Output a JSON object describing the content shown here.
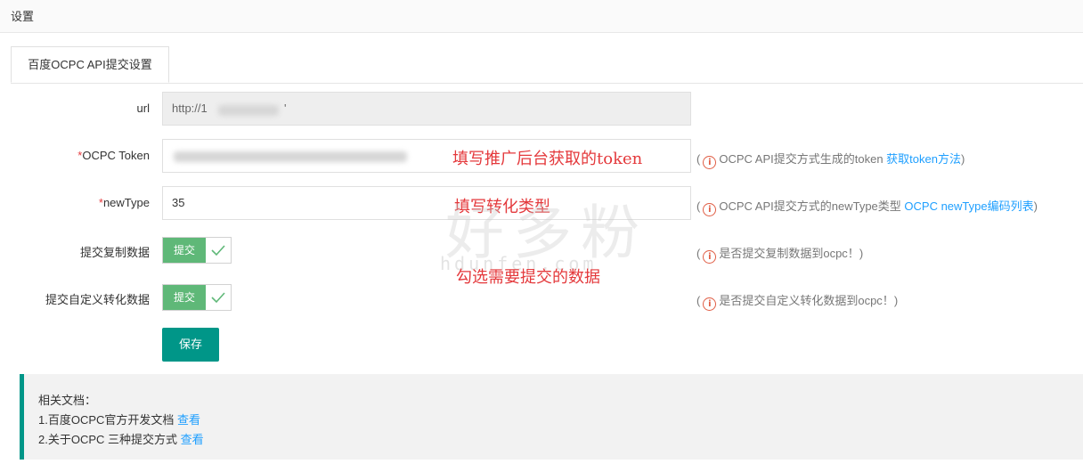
{
  "header": {
    "title": "设置"
  },
  "tab": {
    "label": "百度OCPC API提交设置"
  },
  "form": {
    "url": {
      "label": "url",
      "value": "http://1",
      "value_tail": "'"
    },
    "token": {
      "required_mark": "*",
      "label": "OCPC Token",
      "value": ""
    },
    "newtype": {
      "required_mark": "*",
      "label": "newType",
      "value": "35"
    },
    "copy_data": {
      "label": "提交复制数据",
      "toggle_text": "提交",
      "checked": true
    },
    "custom_conv": {
      "label": "提交自定义转化数据",
      "toggle_text": "提交",
      "checked": true
    }
  },
  "hints": {
    "token": {
      "open": "(",
      "icon": "i",
      "text": "OCPC API提交方式生成的token ",
      "link": "获取token方法",
      "close": ")"
    },
    "newtype": {
      "open": "(",
      "icon": "i",
      "text": "OCPC API提交方式的newType类型 ",
      "link": "OCPC newType编码列表",
      "close": ")"
    },
    "copy_data": {
      "open": "(",
      "icon": "i",
      "text": "是否提交复制数据到ocpc！",
      "close": ")"
    },
    "custom_conv": {
      "open": "(",
      "icon": "i",
      "text": "是否提交自定义转化数据到ocpc！",
      "close": ")"
    }
  },
  "save_button": "保存",
  "annotations": {
    "token": "填写推广后台获取的token",
    "newtype": "填写转化类型",
    "toggles": "勾选需要提交的数据"
  },
  "watermark": {
    "main": "好多粉",
    "url": "hdunfen.com"
  },
  "docs": {
    "title": "相关文档：",
    "items": [
      {
        "text": "1.百度OCPC官方开发文档 ",
        "link": "查看"
      },
      {
        "text": "2.关于OCPC 三种提交方式 ",
        "link": "查看"
      }
    ]
  },
  "colors": {
    "accent": "#009688",
    "toggle_green": "#5fb878",
    "link": "#1e9fff",
    "required": "#e4393c",
    "hint_icon": "#e05d44"
  }
}
